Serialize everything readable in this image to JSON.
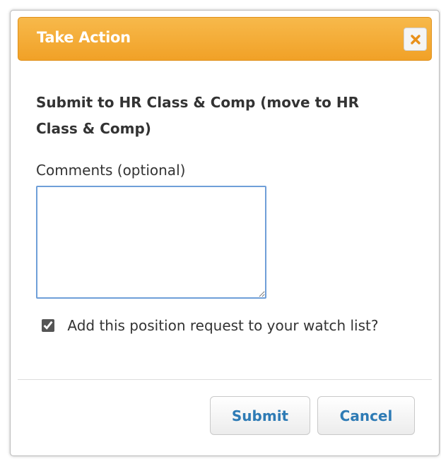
{
  "dialog": {
    "title": "Take Action",
    "close_icon": "close-x-icon",
    "heading": "Submit to HR Class & Comp (move to HR Class & Comp)",
    "comments_label": "Comments (optional)",
    "comments_value": "",
    "watch_label": "Add this position request to your watch list?",
    "watch_checked": true,
    "submit_label": "Submit",
    "cancel_label": "Cancel"
  },
  "colors": {
    "title_bar": "#F1A127",
    "button_text": "#2E7BB5",
    "close_x": "#E8901A"
  }
}
